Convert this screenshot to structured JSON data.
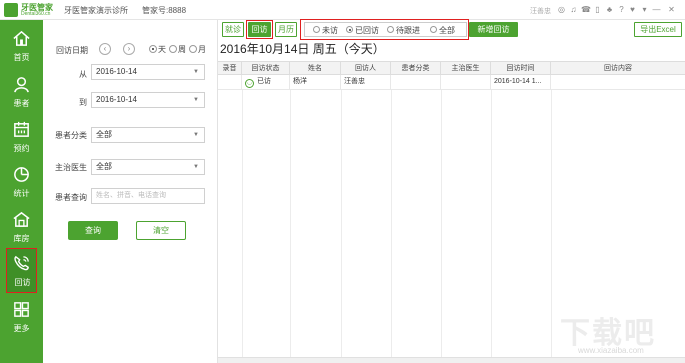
{
  "app": {
    "logo_cn": "牙医管家",
    "logo_en": "Dental360.cn",
    "clinic": "牙医管家演示诊所",
    "account": "管家号:8888",
    "user": "汪善忠"
  },
  "sidebar": {
    "items": [
      {
        "label": "首页",
        "icon": "home-icon"
      },
      {
        "label": "患者",
        "icon": "person-icon"
      },
      {
        "label": "预约",
        "icon": "calendar-icon"
      },
      {
        "label": "统计",
        "icon": "pie-chart-icon"
      },
      {
        "label": "库房",
        "icon": "warehouse-icon"
      },
      {
        "label": "回访",
        "icon": "phone-icon",
        "active": true
      },
      {
        "label": "更多",
        "icon": "grid-icon"
      }
    ]
  },
  "filter": {
    "date_label": "回访日期",
    "range_options": [
      "天",
      "周",
      "月"
    ],
    "selected_range": "天",
    "from_label": "从",
    "from_value": "2016-10-14",
    "to_label": "到",
    "to_value": "2016-10-14",
    "category_label": "患者分类",
    "category_value": "全部",
    "doctor_label": "主治医生",
    "doctor_value": "全部",
    "search_label": "患者查询",
    "search_placeholder": "姓名、拼音、电话查询",
    "query_button": "查询",
    "clear_button": "清空"
  },
  "toolbar": {
    "tabs": [
      "就诊",
      "回访",
      "月历"
    ],
    "active_tab": "回访",
    "status_options": [
      "未访",
      "已回访",
      "待跟进",
      "全部"
    ],
    "selected_status": "已回访",
    "add_button": "新增回访",
    "export_button": "导出Excel"
  },
  "date_header": "2016年10月14日 周五（今天）",
  "table": {
    "columns": [
      "录音",
      "回访状态",
      "姓名",
      "回访人",
      "患者分类",
      "主治医生",
      "回访时间",
      "回访内容"
    ],
    "rows": [
      {
        "recording": "",
        "status": "已访",
        "name": "杨洋",
        "visitor": "汪善忠",
        "category": "",
        "doctor": "",
        "time": "2016-10-14 1...",
        "content": ""
      }
    ]
  },
  "watermark": {
    "big": "下载吧",
    "small": "www.xiazaiba.com"
  },
  "colors": {
    "accent": "#4ca330",
    "highlight": "#e02020"
  }
}
